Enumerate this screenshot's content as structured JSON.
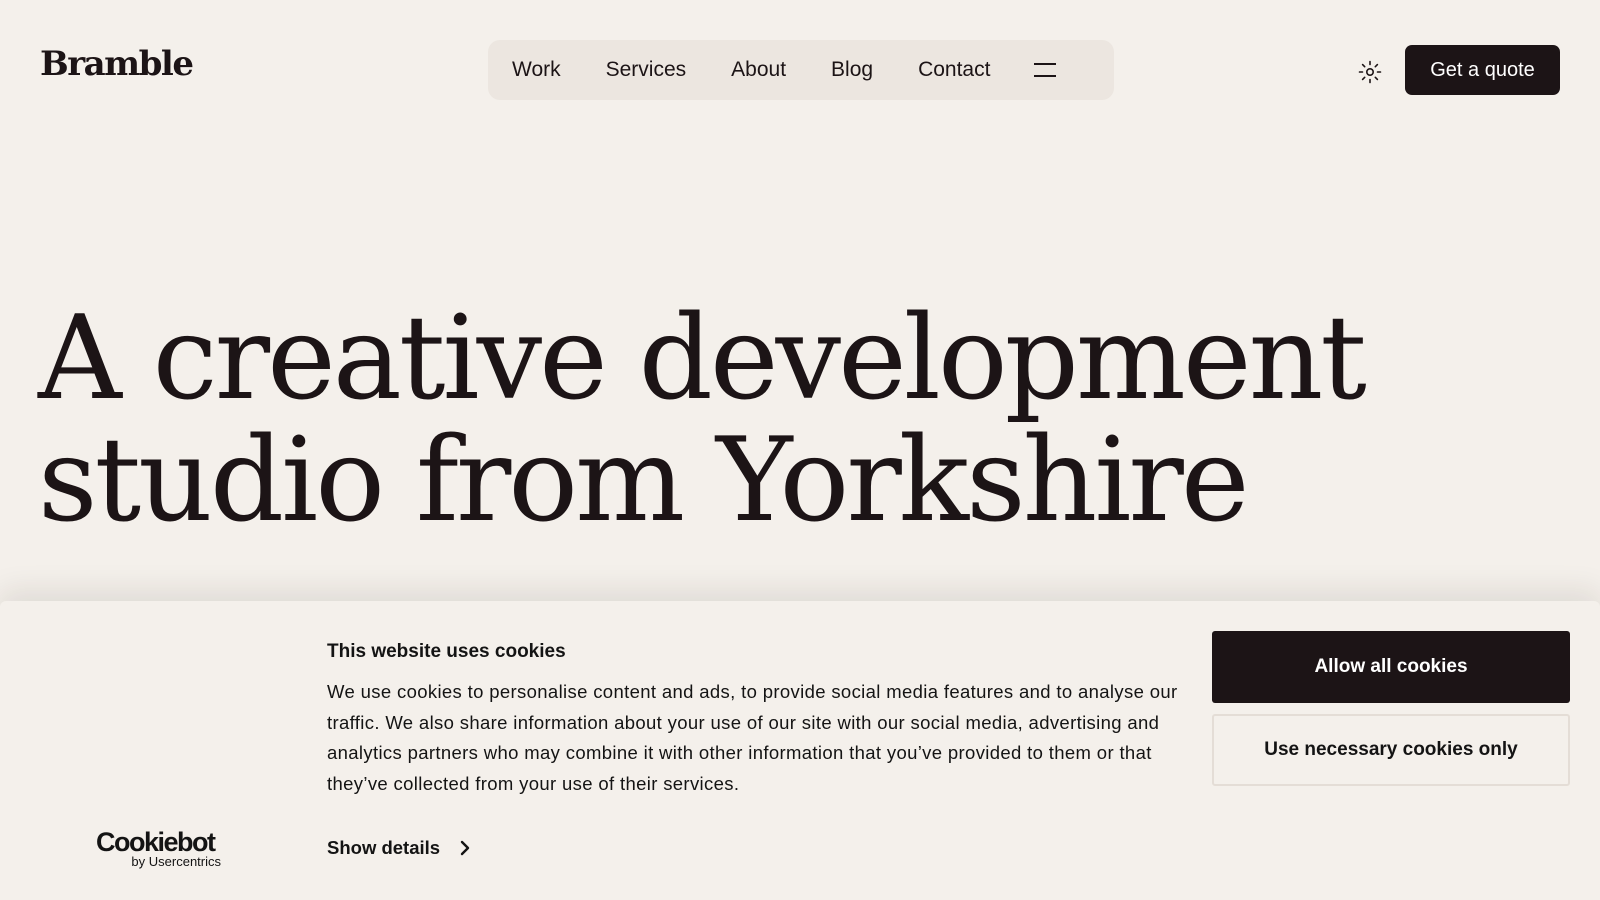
{
  "header": {
    "logo": "Bramble",
    "nav": [
      "Work",
      "Services",
      "About",
      "Blog",
      "Contact"
    ],
    "menu_icon": "hamburger-menu-icon",
    "theme_icon": "sun-icon",
    "cta_label": "Get a quote"
  },
  "hero": {
    "line1": "A creative development",
    "line2": "studio from Yorkshire"
  },
  "cookie_banner": {
    "title": "This website uses cookies",
    "body": "We use cookies to personalise content and ads, to provide social media features and to analyse our traffic. We also share information about your use of our site with our social media, advertising and analytics partners who may combine it with other information that you’ve provided to them or that they’ve collected from your use of their services.",
    "show_details": "Show details",
    "allow_all": "Allow all cookies",
    "necessary_only": "Use necessary cookies only",
    "brand_name": "Cookiebot",
    "brand_sub": "by Usercentrics"
  },
  "colors": {
    "background": "#f4f0eb",
    "ink": "#1c1416",
    "nav_background": "#ece6e0"
  }
}
